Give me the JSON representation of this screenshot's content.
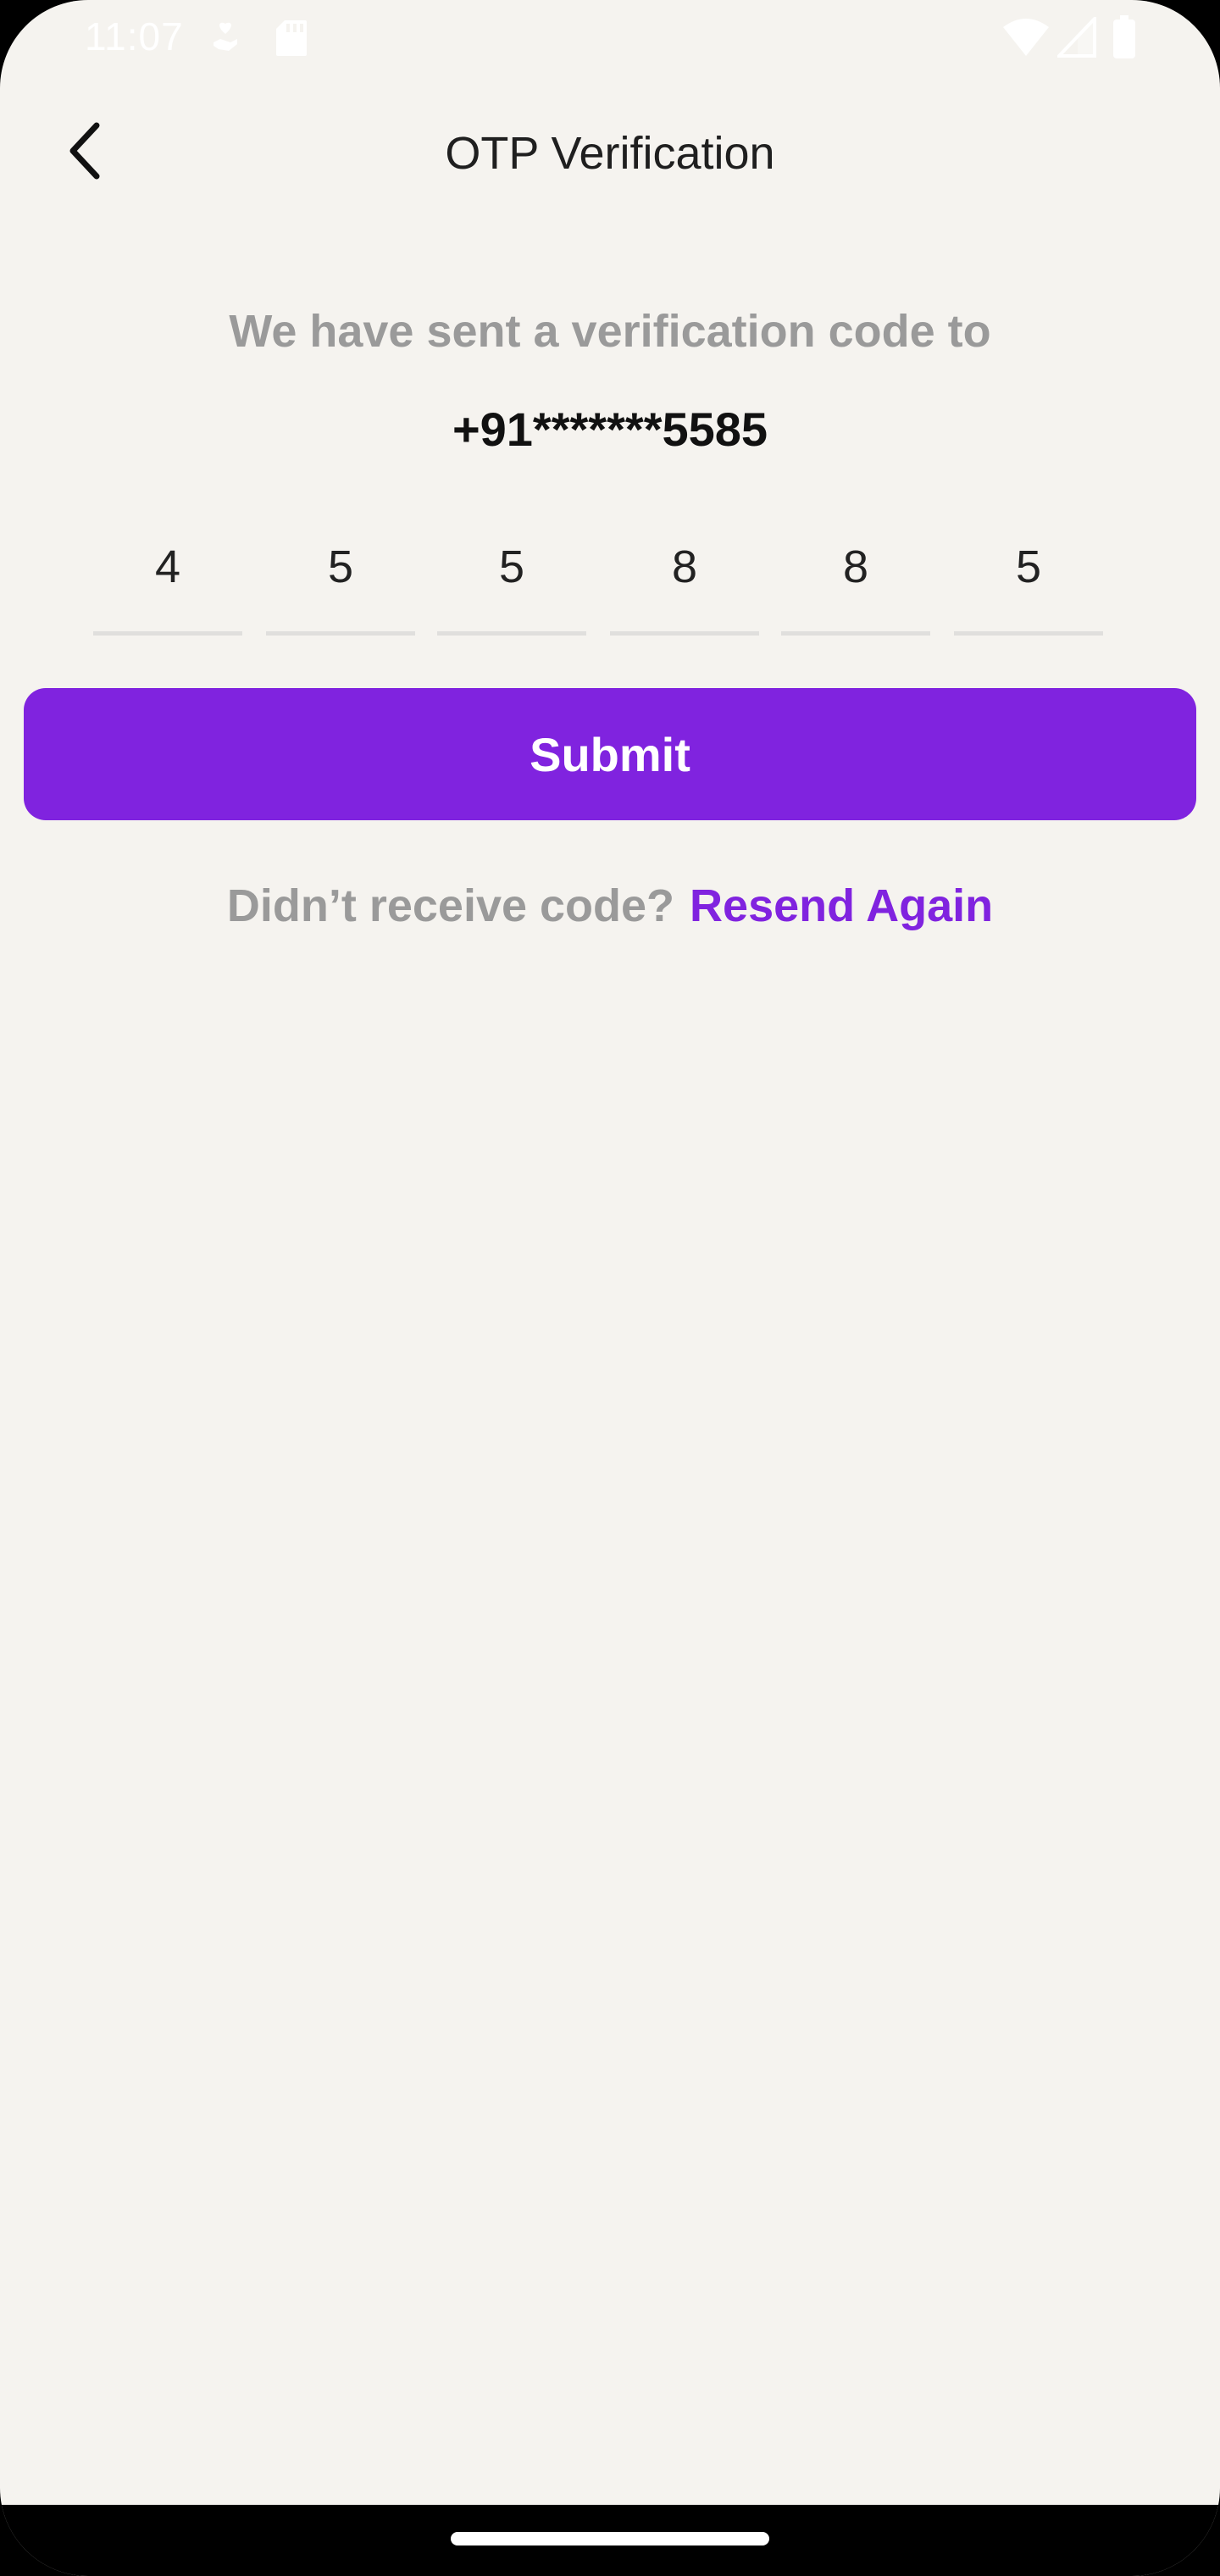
{
  "status_bar": {
    "time": "11:07",
    "icons": [
      "hand-heart-icon",
      "sd-card-icon",
      "wifi-icon",
      "signal-icon",
      "battery-icon"
    ]
  },
  "header": {
    "title": "OTP Verification",
    "back_icon": "chevron-left-icon"
  },
  "main": {
    "subtitle": "We have sent a verification code to",
    "phone_number": "+91*******5585",
    "otp_digits": [
      "4",
      "5",
      "5",
      "8",
      "8",
      "5"
    ],
    "submit_label": "Submit",
    "resend_prompt": "Didn’t receive code?",
    "resend_link": "Resend Again"
  },
  "colors": {
    "accent": "#8023df",
    "background": "#f5f3ef",
    "muted_text": "#9a9a9a"
  }
}
